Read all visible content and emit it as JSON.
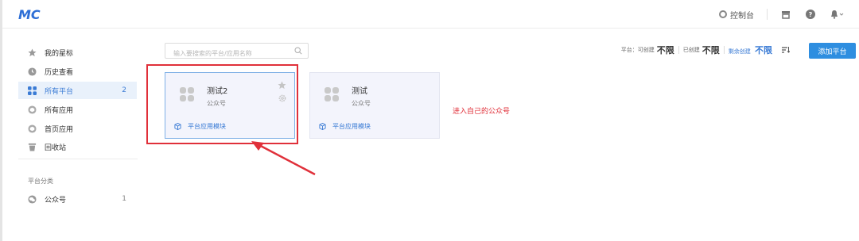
{
  "app": {
    "logo_text": "MC"
  },
  "topbar": {
    "console_label": "控制台"
  },
  "sidebar": {
    "items": [
      {
        "label": "我的星标",
        "icon": "star-icon",
        "count": ""
      },
      {
        "label": "历史查看",
        "icon": "clock-icon",
        "count": ""
      },
      {
        "label": "所有平台",
        "icon": "grid-icon",
        "count": "2"
      },
      {
        "label": "所有应用",
        "icon": "cube-icon",
        "count": ""
      },
      {
        "label": "首页应用",
        "icon": "cube-icon",
        "count": ""
      },
      {
        "label": "回收站",
        "icon": "trash-icon",
        "count": ""
      }
    ],
    "active_index": 2,
    "section_title": "平台分类",
    "categories": [
      {
        "label": "公众号",
        "icon": "wechat-icon",
        "count": "1"
      }
    ]
  },
  "search": {
    "placeholder": "输入要搜索的平台/应用名称"
  },
  "stats": {
    "platform_label": "平台：",
    "can_create_label": "可创建",
    "can_create_value": "不限",
    "created_label": "已创建",
    "created_value": "不限",
    "remaining_label": "剩余创建",
    "remaining_value": "不限"
  },
  "add_button_label": "添加平台",
  "cards": [
    {
      "title": "测试2",
      "type": "公众号",
      "footer": "平台应用模块"
    },
    {
      "title": "测试",
      "type": "公众号",
      "footer": "平台应用模块"
    }
  ],
  "annotation": {
    "note": "进入自己的公众号",
    "color": "#e0303a"
  },
  "colors": {
    "accent": "#3a7bd5",
    "button": "#2e8ee0"
  }
}
